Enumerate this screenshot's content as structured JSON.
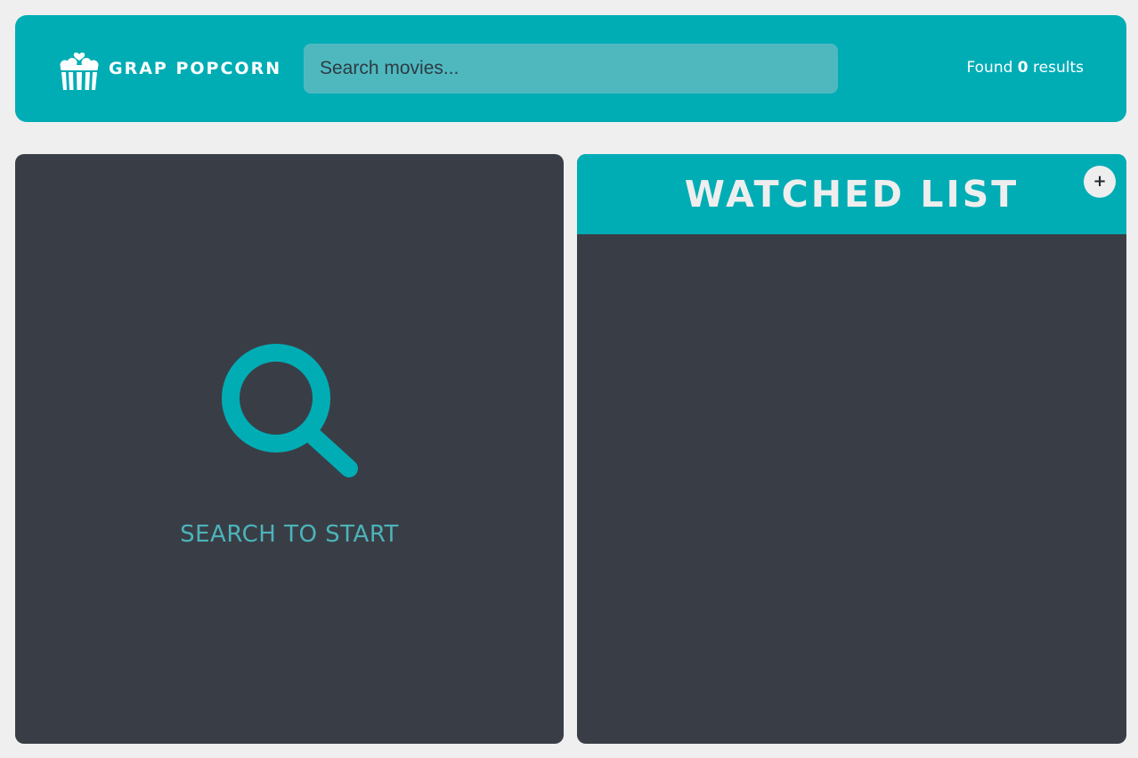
{
  "app": {
    "logo_text": "GRAP POPCORN",
    "logo_icon": "popcorn-icon"
  },
  "search": {
    "placeholder": "Search movies...",
    "value": ""
  },
  "results": {
    "prefix": "Found",
    "count": "0",
    "suffix": "results"
  },
  "search_panel": {
    "icon": "search-icon",
    "message": "SEARCH TO START"
  },
  "watched": {
    "title": "WATCHED LIST",
    "toggle_label": "+"
  },
  "colors": {
    "accent": "#00adb5",
    "panel": "#393e46",
    "background": "#efefef",
    "text_light": "#eeeeee"
  }
}
